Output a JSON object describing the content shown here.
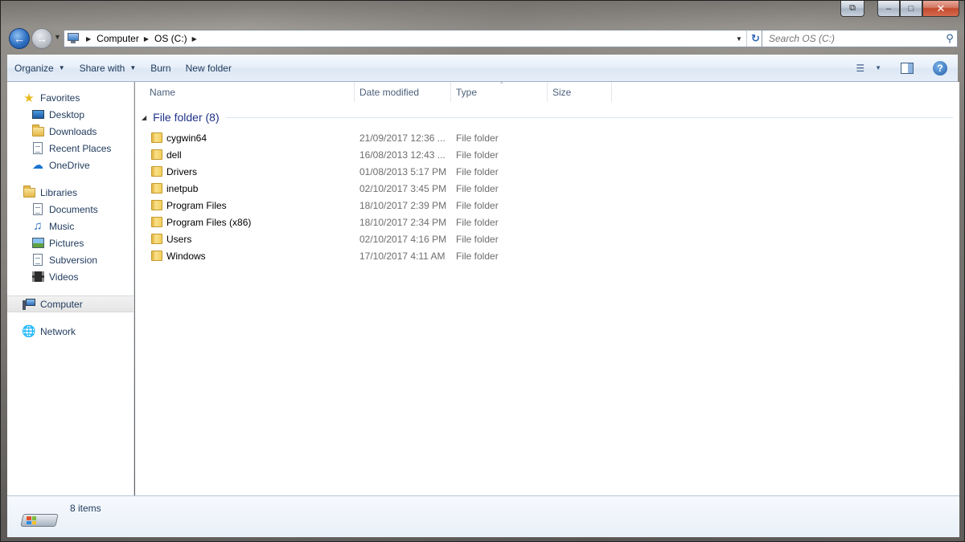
{
  "window": {
    "caption": {
      "snap_glyph": "⧉",
      "minimize_glyph": "–",
      "maximize_glyph": "□",
      "close_glyph": "✕"
    }
  },
  "navigation": {
    "breadcrumb": [
      "Computer",
      "OS (C:)"
    ],
    "search_placeholder": "Search OS (C:)"
  },
  "toolbar": {
    "organize_label": "Organize",
    "share_label": "Share with",
    "burn_label": "Burn",
    "new_folder_label": "New folder",
    "help_glyph": "?"
  },
  "sidebar": {
    "favorites": {
      "label": "Favorites",
      "items": [
        {
          "label": "Desktop",
          "icon": "desktop-icon"
        },
        {
          "label": "Downloads",
          "icon": "downloads-folder-icon"
        },
        {
          "label": "Recent Places",
          "icon": "recent-places-icon"
        },
        {
          "label": "OneDrive",
          "icon": "onedrive-cloud-icon"
        }
      ]
    },
    "libraries": {
      "label": "Libraries",
      "items": [
        {
          "label": "Documents",
          "icon": "documents-icon"
        },
        {
          "label": "Music",
          "icon": "music-icon"
        },
        {
          "label": "Pictures",
          "icon": "pictures-icon"
        },
        {
          "label": "Subversion",
          "icon": "subversion-icon"
        },
        {
          "label": "Videos",
          "icon": "videos-icon"
        }
      ]
    },
    "computer": {
      "label": "Computer",
      "selected": true
    },
    "network": {
      "label": "Network"
    }
  },
  "columns": {
    "name": "Name",
    "date_modified": "Date modified",
    "type": "Type",
    "size": "Size"
  },
  "group": {
    "title": "File folder (8)"
  },
  "files": [
    {
      "name": "cygwin64",
      "date": "21/09/2017 12:36 ...",
      "type": "File folder"
    },
    {
      "name": "dell",
      "date": "16/08/2013 12:43 ...",
      "type": "File folder"
    },
    {
      "name": "Drivers",
      "date": "01/08/2013 5:17 PM",
      "type": "File folder"
    },
    {
      "name": "inetpub",
      "date": "02/10/2017 3:45 PM",
      "type": "File folder"
    },
    {
      "name": "Program Files",
      "date": "18/10/2017 2:39 PM",
      "type": "File folder"
    },
    {
      "name": "Program Files (x86)",
      "date": "18/10/2017 2:34 PM",
      "type": "File folder"
    },
    {
      "name": "Users",
      "date": "02/10/2017 4:16 PM",
      "type": "File folder"
    },
    {
      "name": "Windows",
      "date": "17/10/2017 4:11 AM",
      "type": "File folder"
    }
  ],
  "details": {
    "item_count": "8 items"
  },
  "colors": {
    "group_title": "#1e3287",
    "nav_text": "#1e395b",
    "secondary_text": "#6d6d6d"
  }
}
